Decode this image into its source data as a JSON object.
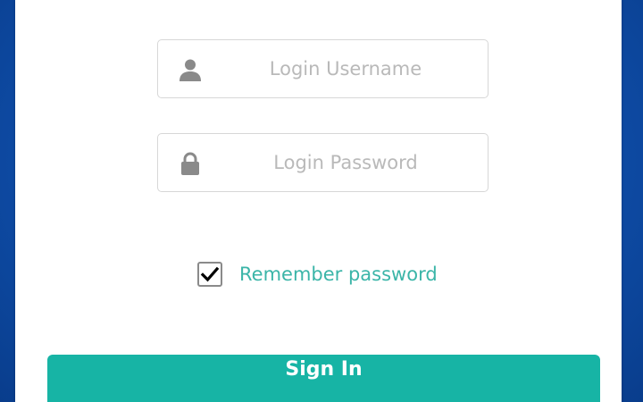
{
  "login_form": {
    "username": {
      "placeholder": "Login Username",
      "value": "",
      "icon": "user-icon"
    },
    "password": {
      "placeholder": "Login Password",
      "value": "",
      "icon": "lock-icon"
    },
    "remember": {
      "label": "Remember password",
      "checked": true
    },
    "submit_label": "Sign In"
  },
  "colors": {
    "background": "#0f4eaa",
    "accent": "#17b4a5",
    "link_text": "#3bb5a8",
    "icon": "#8a8a8a",
    "placeholder": "#b9b9b9"
  }
}
